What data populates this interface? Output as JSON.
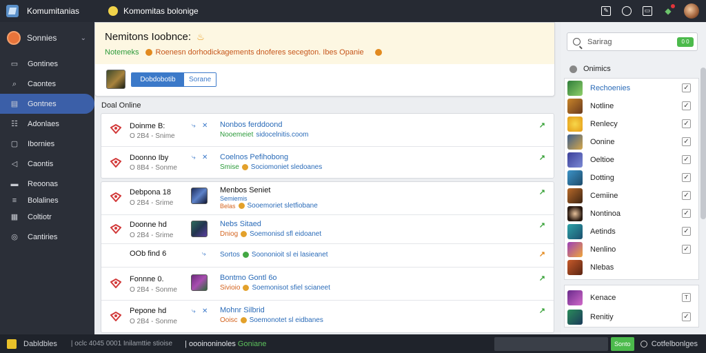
{
  "colors": {
    "topbar": "#262a33",
    "sidebar": "#2b2f38",
    "sidebar_active": "#3b5fa8",
    "accent_blue": "#3b79c9",
    "green": "#3aa33a",
    "orange": "#e38a1f",
    "banner_bg": "#fdf7e2"
  },
  "topbar": {
    "app_name": "Komumitanias",
    "window_title": "Komomitas bolonige",
    "icons": [
      "edit-icon",
      "chat-icon",
      "screen-icon",
      "notification-icon",
      "avatar"
    ]
  },
  "sidebar": {
    "header": "Sonnies",
    "items": [
      {
        "label": "Gontines",
        "icon": "monitor-icon"
      },
      {
        "label": "Caontes",
        "icon": "search-icon"
      },
      {
        "label": "Gontnes",
        "icon": "chart-icon",
        "active": true
      },
      {
        "label": "Adonlaes",
        "icon": "bars-icon"
      },
      {
        "label": "Ibornies",
        "icon": "square-icon"
      },
      {
        "label": "Caontis",
        "icon": "arrow-icon"
      },
      {
        "label": "Reoonas",
        "icon": "list-icon"
      },
      {
        "label": "Bolalines",
        "icon": "sliders-icon"
      },
      {
        "label": "Coltiotr",
        "icon": "grid-icon"
      },
      {
        "label": "Cantiries",
        "icon": "globe-icon"
      }
    ]
  },
  "banner": {
    "title": "Nemitons Ioobnce:",
    "sub_key": "Notemeks",
    "sub_text": "Roenesn dorhodickagements dnoferes secegton. Ibes Opanie",
    "segment": {
      "active": "Dobdobotib",
      "inactive": "Sorane"
    }
  },
  "section_label": "Doal Online",
  "rows": [
    {
      "name": "Doinme B:",
      "meta": "O 2B4  -  Snime",
      "primary": "Nonbos ferddoond",
      "secondary_a": "Nooemeiet",
      "secondary_b": "sidocelnitis.coom",
      "color": "green",
      "trend": "up"
    },
    {
      "name": "Doonno Iby",
      "meta": "O 8B4  -  Sonme",
      "primary": "Coelnos Pefihobong",
      "secondary_a": "Smise",
      "secondary_b": "Sociomoniet  sledoanes",
      "color": "green",
      "trend": "up"
    },
    {
      "name": "Debpona 18",
      "meta": "O 2B4  -  Srime",
      "primary": "Menbos Seniet",
      "secondary_a": "Semiemis",
      "secondary_b": "Sooemoriet  sletfiobane",
      "color": "orange",
      "trend": "up"
    },
    {
      "name": "Doonne hd",
      "meta": "O 2B4  -  Srime",
      "primary": "Nebs Sitaed",
      "secondary_a": "Dniog",
      "secondary_b": "Soemonisd  sfl  eidoanet",
      "color": "orange",
      "trend": "up"
    },
    {
      "name": "OOb find  6",
      "meta": "",
      "primary": "",
      "secondary_a": "Sortos",
      "secondary_b": "Soononioit  sl ei  lasieanet",
      "color": "blue",
      "trend": "orange"
    },
    {
      "name": "Fonnne 0.",
      "meta": "O 2B4  -  Sonme",
      "primary": "Bontmo Gontl 6o",
      "secondary_a": "Sivioio",
      "secondary_b": "Soemonisot  sfiel  scianeet",
      "color": "orange",
      "trend": "up"
    },
    {
      "name": "Pepone hd",
      "meta": "O 2B4  -  Sonme",
      "primary": "Mohnr Silbrid",
      "secondary_a": "Ooisc",
      "secondary_b": "Soemonotet  sl  eidbanes",
      "color": "orange",
      "trend": "up"
    }
  ],
  "right_panel": {
    "search_placeholder": "Sarirag",
    "toggle_label": "0 0",
    "header": "Onimics",
    "items": [
      {
        "label": "Rechoenies",
        "link": true
      },
      {
        "label": "Notline"
      },
      {
        "label": "Renlecy"
      },
      {
        "label": "Oonine"
      },
      {
        "label": "Oeltioe"
      },
      {
        "label": "Dotting"
      },
      {
        "label": "Cemiine"
      },
      {
        "label": "Nontinoa"
      },
      {
        "label": "Aetinds"
      },
      {
        "label": "Nenlino"
      },
      {
        "label": "Nlebas"
      }
    ],
    "items2": [
      {
        "label": "Kenace"
      },
      {
        "label": "Renitiy"
      }
    ]
  },
  "bottombar": {
    "left_label": "Dabldbles",
    "status": "| oclc 4045  0001 Inilamttie stioise",
    "channel_a": "oooinoninoles",
    "channel_b": "Goniane",
    "send_label": "Sonto",
    "right_label": "Cotfelbonlges"
  }
}
